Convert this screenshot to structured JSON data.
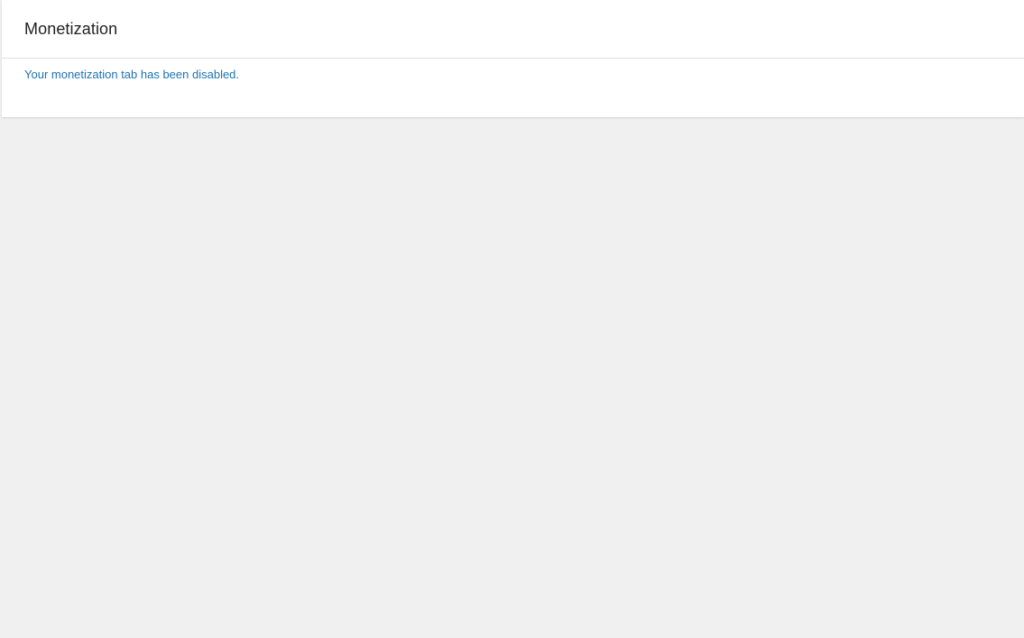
{
  "header": {
    "title": "Monetization"
  },
  "main": {
    "status_message": "Your monetization tab has been disabled."
  },
  "colors": {
    "background": "#f0f0f0",
    "card": "#ffffff",
    "title_text": "#222222",
    "message_text": "#1e73b4"
  }
}
